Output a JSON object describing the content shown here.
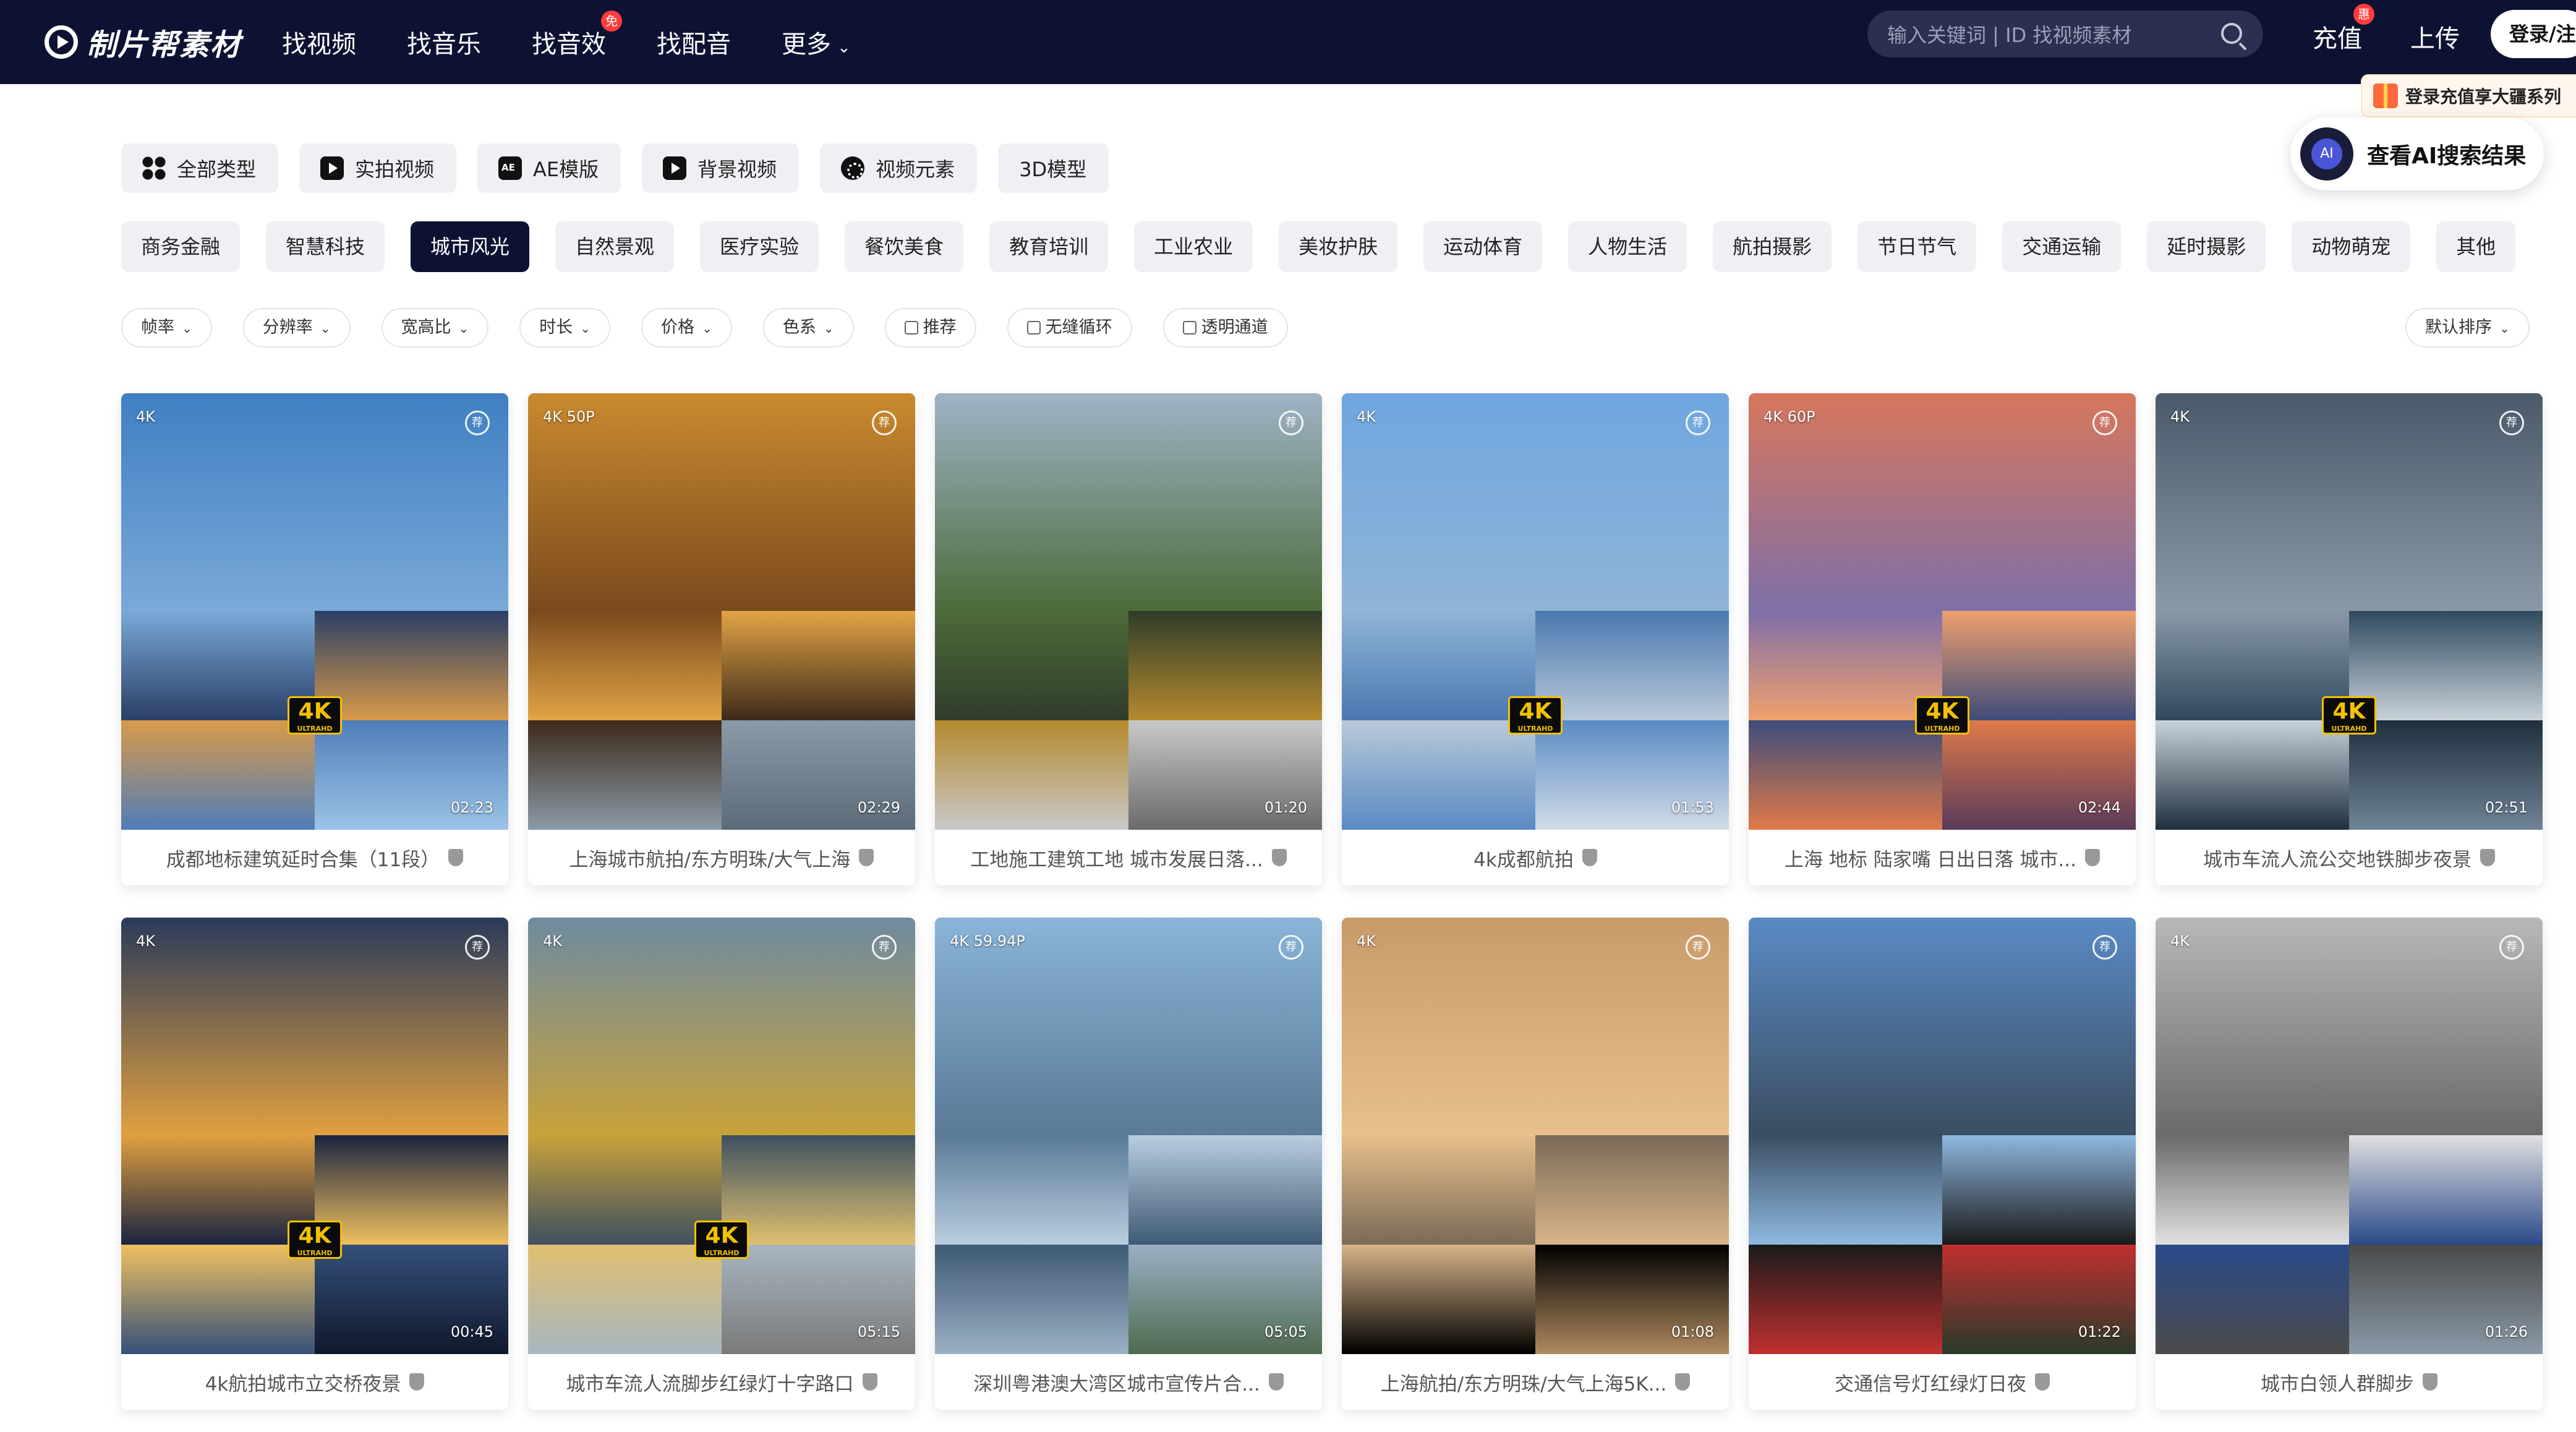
{
  "brand": {
    "name": "制片帮素材"
  },
  "nav": {
    "items": [
      {
        "label": "找视频"
      },
      {
        "label": "找音乐"
      },
      {
        "label": "找音效",
        "badge": "免"
      },
      {
        "label": "找配音"
      },
      {
        "label": "更多",
        "chevron": "chevron-down-icon"
      }
    ]
  },
  "search": {
    "placeholder": "输入关键词 | ID 找视频素材",
    "icon": "search-icon"
  },
  "header_actions": {
    "recharge_label": "充值",
    "recharge_badge": "惠",
    "upload_label": "上传",
    "login_label": "登录/注"
  },
  "promo": {
    "text": "登录充值享大疆系列"
  },
  "ai_search": {
    "label": "查看AI搜索结果"
  },
  "categories": [
    {
      "label": "全部类型",
      "icon": "grid-icon"
    },
    {
      "label": "实拍视频",
      "icon": "video-play-icon"
    },
    {
      "label": "AE模版",
      "icon": "ae-icon"
    },
    {
      "label": "背景视频",
      "icon": "video-play-icon"
    },
    {
      "label": "视频元素",
      "icon": "element-icon"
    },
    {
      "label": "3D模型",
      "icon": ""
    }
  ],
  "tags": [
    {
      "label": "商务金融",
      "active": false
    },
    {
      "label": "智慧科技",
      "active": false
    },
    {
      "label": "城市风光",
      "active": true
    },
    {
      "label": "自然景观",
      "active": false
    },
    {
      "label": "医疗实验",
      "active": false
    },
    {
      "label": "餐饮美食",
      "active": false
    },
    {
      "label": "教育培训",
      "active": false
    },
    {
      "label": "工业农业",
      "active": false
    },
    {
      "label": "美妆护肤",
      "active": false
    },
    {
      "label": "运动体育",
      "active": false
    },
    {
      "label": "人物生活",
      "active": false
    },
    {
      "label": "航拍摄影",
      "active": false
    },
    {
      "label": "节日节气",
      "active": false
    },
    {
      "label": "交通运输",
      "active": false
    },
    {
      "label": "延时摄影",
      "active": false
    },
    {
      "label": "动物萌宠",
      "active": false
    },
    {
      "label": "其他",
      "active": false
    }
  ],
  "filters": {
    "dropdowns": [
      "帧率",
      "分辨率",
      "宽高比",
      "时长",
      "价格",
      "色系"
    ],
    "checkboxes": [
      "推荐",
      "无缝循环",
      "透明通道"
    ],
    "sort_label": "默认排序"
  },
  "videos": [
    {
      "title": "成都地标建筑延时合集（11段）",
      "resolution": "4K",
      "duration": "02:23",
      "k4": true,
      "palette": [
        "#3f7fc2",
        "#7aa9d8",
        "#2a3f66",
        "#d89a4a",
        "#4f7db8",
        "#9cc3e6"
      ]
    },
    {
      "title": "上海城市航拍/东方明珠/大气上海",
      "resolution": "4K  50P",
      "duration": "02:29",
      "k4": false,
      "palette": [
        "#c98a2e",
        "#7a4a1e",
        "#e2a445",
        "#3d2a1a",
        "#8a9aa8",
        "#5c6b78"
      ]
    },
    {
      "title": "工地施工建筑工地 城市发展日落...",
      "resolution": "",
      "duration": "01:20",
      "k4": false,
      "palette": [
        "#9fb3c6",
        "#4d6b3a",
        "#2f3c2a",
        "#b58a2e",
        "#c8c8c8",
        "#6b6b6b"
      ]
    },
    {
      "title": "4k成都航拍",
      "resolution": "4K",
      "duration": "01:53",
      "k4": true,
      "palette": [
        "#6fa6e0",
        "#8fb4d6",
        "#4a78b0",
        "#b9c9d8",
        "#5a8ac4",
        "#d1dce6"
      ]
    },
    {
      "title": "上海 地标 陆家嘴 日出日落 城市...",
      "resolution": "4K  60P",
      "duration": "02:44",
      "k4": true,
      "palette": [
        "#d7775c",
        "#7e6fa8",
        "#f0a06c",
        "#3d4c7a",
        "#e07a4a",
        "#5a3a5a"
      ]
    },
    {
      "title": "城市车流人流公交地铁脚步夜景",
      "resolution": "4K",
      "duration": "02:51",
      "k4": true,
      "palette": [
        "#4a5a6a",
        "#8a99a8",
        "#2f4a5e",
        "#c8d2da",
        "#1f2f3e",
        "#6f8496"
      ]
    },
    {
      "title": "4k航拍城市立交桥夜景",
      "resolution": "4K",
      "duration": "00:45",
      "k4": true,
      "palette": [
        "#2a3a5a",
        "#e0a040",
        "#1a2440",
        "#f0c060",
        "#34507a",
        "#10182c"
      ]
    },
    {
      "title": "城市车流人流脚步红绿灯十字路口",
      "resolution": "4K",
      "duration": "05:15",
      "k4": true,
      "palette": [
        "#6e8ba0",
        "#c9a23a",
        "#3e5060",
        "#e0c070",
        "#a8b6c0",
        "#7a7a7a"
      ]
    },
    {
      "title": "深圳粤港澳大湾区城市宣传片合...",
      "resolution": "4K  59.94P",
      "duration": "05:05",
      "k4": false,
      "palette": [
        "#8ab4d8",
        "#5a7a96",
        "#b8cee0",
        "#3e5a74",
        "#9ab0c4",
        "#4f6a50"
      ]
    },
    {
      "title": "上海航拍/东方明珠/大气上海5K...",
      "resolution": "4K",
      "duration": "01:08",
      "k4": false,
      "palette": [
        "#c89a6a",
        "#e8c08a",
        "#7a6a58",
        "#d8b48a",
        "#000000",
        "#b08a60"
      ]
    },
    {
      "title": "交通信号灯红绿灯日夜",
      "resolution": "",
      "duration": "01:22",
      "k4": false,
      "palette": [
        "#5a8ac4",
        "#3a4e62",
        "#8fb8e0",
        "#1a1a1a",
        "#c03030",
        "#2a3a2a"
      ]
    },
    {
      "title": "城市白领人群脚步",
      "resolution": "4K",
      "duration": "01:26",
      "k4": false,
      "palette": [
        "#b8b8b8",
        "#6a6a6a",
        "#e0e0e0",
        "#2a4a8a",
        "#4a4a4a",
        "#8a9aa8"
      ]
    }
  ]
}
